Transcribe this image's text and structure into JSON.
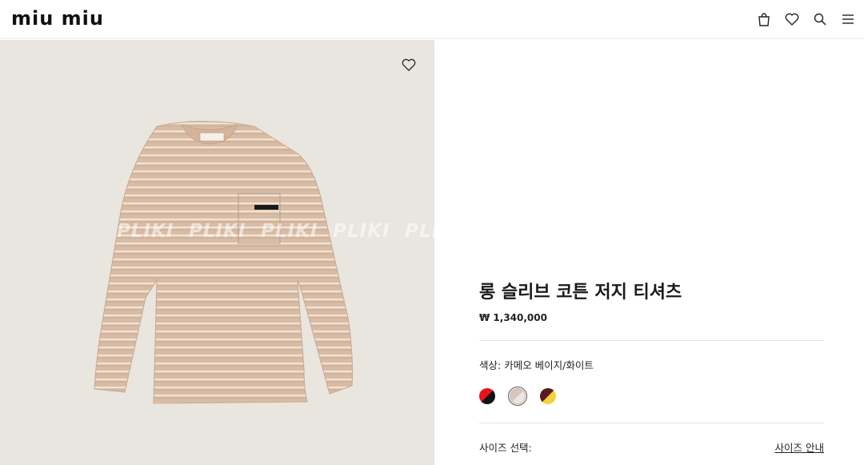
{
  "header": {
    "logo": "miu miu",
    "icons": [
      "bag-icon",
      "heart-icon",
      "search-icon",
      "menu-icon"
    ]
  },
  "gallery": {
    "wishlist_icon": "heart-icon",
    "watermarks": [
      "PLIKI",
      "PLIKI",
      "PLIKI",
      "PLIKI",
      "PLI"
    ],
    "colors": {
      "background": "#e9e5df",
      "shirt": "#d8b9a0",
      "stripe": "#efe3d7"
    }
  },
  "product": {
    "title": "롱 슬리브 코튼 저지 티셔츠",
    "price": "₩ 1,340,000",
    "color_label": "색상:",
    "color_value": "카메오 베이지/화이트",
    "swatches": [
      {
        "name": "red-black",
        "colors": [
          "#e8141c",
          "#111111"
        ],
        "selected": false
      },
      {
        "name": "cameo-beige-white",
        "colors": [
          "#d8c6bc",
          "#efe6e0"
        ],
        "selected": true
      },
      {
        "name": "burgundy-yellow",
        "colors": [
          "#5a1a20",
          "#f2d33a"
        ],
        "selected": false
      }
    ],
    "size_label": "사이즈 선택:",
    "size_guide": "사이즈 안내"
  }
}
